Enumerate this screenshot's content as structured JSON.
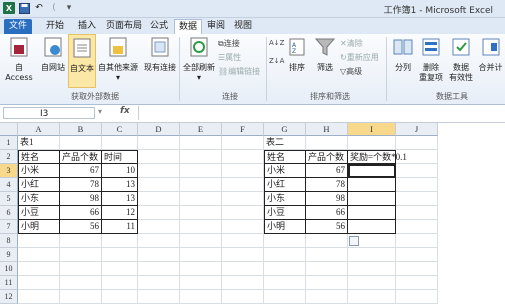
{
  "window": {
    "title": "工作簿1 - Microsoft Excel",
    "qat_sep": "("
  },
  "tabs": [
    "文件",
    "开始",
    "插入",
    "页面布局",
    "公式",
    "数据",
    "审阅",
    "视图"
  ],
  "ribbon": {
    "external": {
      "access": "自 Access",
      "web": "自网站",
      "text": "自文本",
      "other": "自其他来源",
      "existing": "现有连接",
      "group": "获取外部数据"
    },
    "connections": {
      "refresh": "全部刷新",
      "conn": "连接",
      "props": "属性",
      "edit": "编辑链接",
      "group": "连接"
    },
    "sort": {
      "sort": "排序",
      "filter": "筛选",
      "clear": "清除",
      "reapply": "重新应用",
      "adv": "高级",
      "group": "排序和筛选"
    },
    "tools": {
      "split": "分列",
      "dup1": "删除",
      "dup2": "重复项",
      "valid1": "数据",
      "valid2": "有效性",
      "merge": "合并计",
      "group": "数据工具"
    }
  },
  "formula_bar": {
    "cell": "I3",
    "fx": "fx"
  },
  "columns": [
    "A",
    "B",
    "C",
    "D",
    "E",
    "F",
    "G",
    "H",
    "I",
    "J"
  ],
  "rows": [
    "1",
    "2",
    "3",
    "4",
    "5",
    "6",
    "7",
    "8",
    "9",
    "10",
    "11",
    "12"
  ],
  "table1": {
    "title": "表1",
    "headers": [
      "姓名",
      "产品个数",
      "时间"
    ],
    "rows": [
      [
        "小米",
        "67",
        "10"
      ],
      [
        "小红",
        "78",
        "13"
      ],
      [
        "小东",
        "98",
        "13"
      ],
      [
        "小豆",
        "66",
        "12"
      ],
      [
        "小明",
        "56",
        "11"
      ]
    ]
  },
  "table2": {
    "title": "表二",
    "headers": [
      "姓名",
      "产品个数",
      "奖励=个数*0.1"
    ],
    "rows": [
      [
        "小米",
        "67"
      ],
      [
        "小红",
        "78"
      ],
      [
        "小东",
        "98"
      ],
      [
        "小豆",
        "66"
      ],
      [
        "小明",
        "56"
      ]
    ]
  },
  "colors": {
    "excel_green": "#1f7246",
    "file_tab": "#2a6fbf",
    "selected_header": "#f8d88a"
  }
}
